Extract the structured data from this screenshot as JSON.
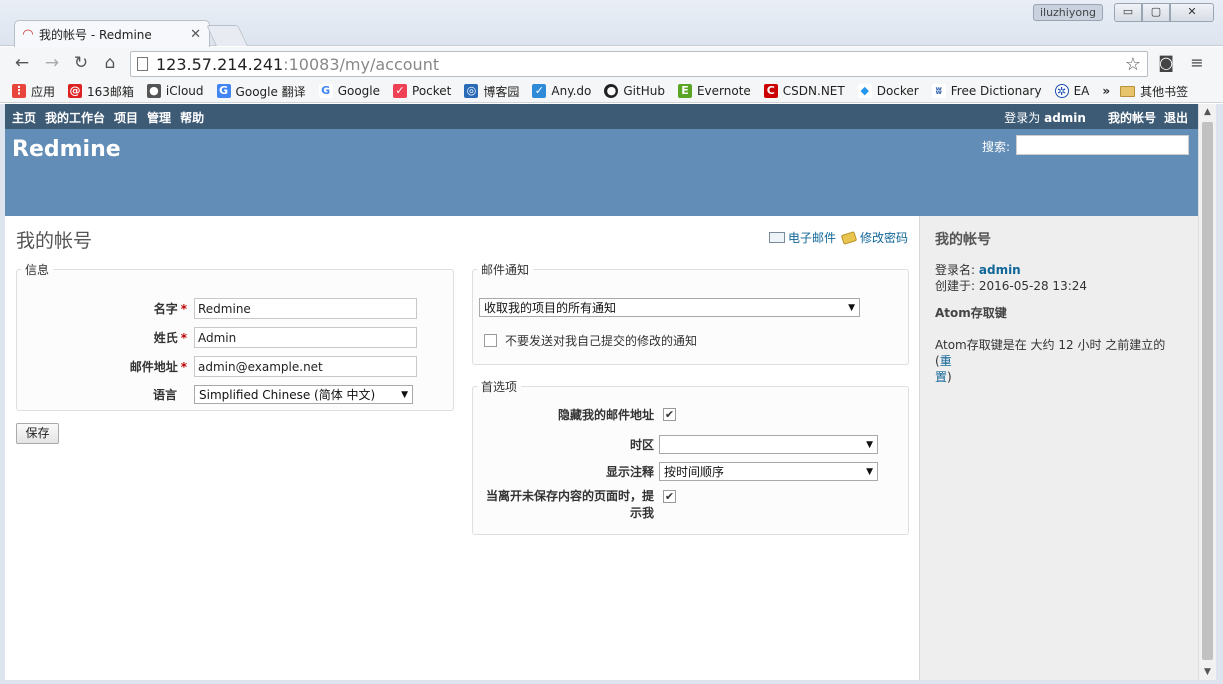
{
  "browser": {
    "tab_title": "我的帐号 - Redmine",
    "user_badge": "iluzhiyong",
    "url_host": "123.57.214.241",
    "url_path": ":10083/my/account",
    "bookmarks": [
      {
        "label": "应用",
        "color": "#e8453c"
      },
      {
        "label": "163邮箱",
        "color": "#d22"
      },
      {
        "label": "iCloud",
        "color": "#555"
      },
      {
        "label": "Google 翻译",
        "color": "#4285f4"
      },
      {
        "label": "Google",
        "color": "#4285f4"
      },
      {
        "label": "Pocket",
        "color": "#ef4056"
      },
      {
        "label": "博客园",
        "color": "#2a6bb8"
      },
      {
        "label": "Any.do",
        "color": "#2f8bd8"
      },
      {
        "label": "GitHub",
        "color": "#222"
      },
      {
        "label": "Evernote",
        "color": "#5ba525"
      },
      {
        "label": "CSDN.NET",
        "color": "#c00"
      },
      {
        "label": "Docker",
        "color": "#2496ed"
      },
      {
        "label": "Free Dictionary",
        "color": "#2b5fa6"
      },
      {
        "label": "EA",
        "color": "#1b4fb2"
      }
    ],
    "bookmarks_more": "»",
    "other_bookmarks": "其他书签"
  },
  "top_menu": {
    "items": [
      "主页",
      "我的工作台",
      "项目",
      "管理",
      "帮助"
    ],
    "logged_as_prefix": "登录为",
    "logged_as_user": "admin",
    "my_account": "我的帐号",
    "logout": "退出"
  },
  "header": {
    "site_title": "Redmine",
    "search_label": "搜索:"
  },
  "page": {
    "title": "我的帐号",
    "email_link": "电子邮件",
    "password_link": "修改密码",
    "info_legend": "信息",
    "fields": {
      "firstname_label": "名字",
      "firstname_value": "Redmine",
      "lastname_label": "姓氏",
      "lastname_value": "Admin",
      "email_label": "邮件地址",
      "email_value": "admin@example.net",
      "language_label": "语言",
      "language_value": "Simplified Chinese (简体 中文)"
    },
    "save_button": "保存",
    "mail_legend": "邮件通知",
    "mail_option": "收取我的项目的所有通知",
    "no_self_notified": "不要发送对我自己提交的修改的通知",
    "pref_legend": "首选项",
    "prefs": {
      "hide_mail_label": "隐藏我的邮件地址",
      "timezone_label": "时区",
      "timezone_value": "",
      "comments_label": "显示注释",
      "comments_value": "按时间顺序",
      "warn_label_line1": "当离开未保存内容的页面时，提",
      "warn_label_line2": "示我"
    }
  },
  "sidebar": {
    "title": "我的帐号",
    "login_label": "登录名:",
    "login_value": "admin",
    "created_label": "创建于:",
    "created_value": "2016-05-28 13:24",
    "atom_title": "Atom存取键",
    "atom_text": "Atom存取键是在 大约 12 小时 之前建立的 (",
    "atom_reset_1": "重",
    "atom_reset_2": "置",
    "atom_close": ")"
  },
  "colors": {
    "top_menu_bg": "#3e5b76",
    "header_bg": "#628db6",
    "link": "#116699",
    "required": "#bb0000"
  }
}
